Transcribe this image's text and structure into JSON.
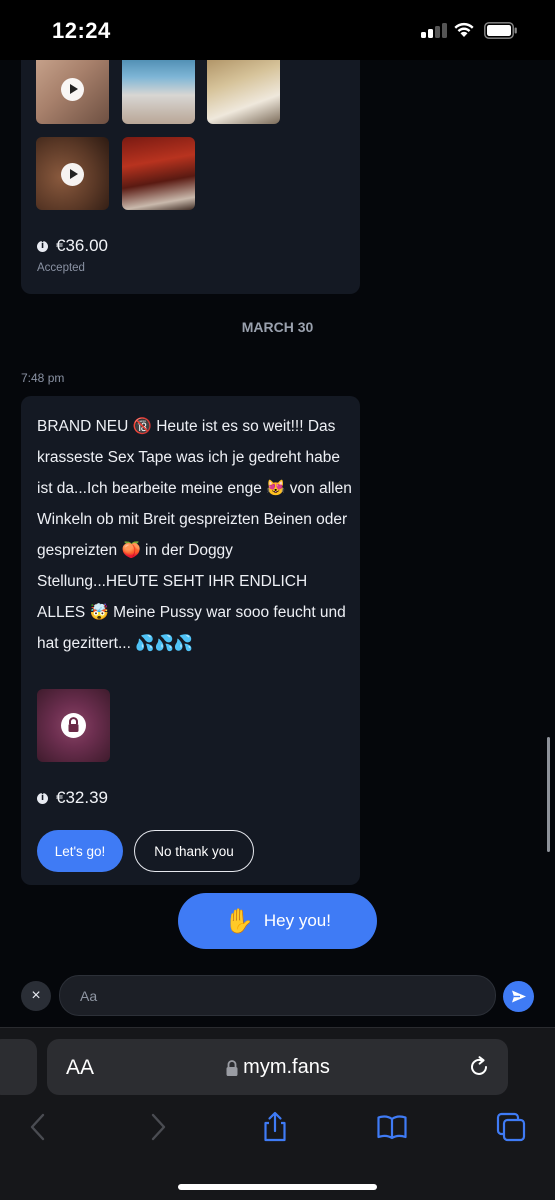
{
  "status_bar": {
    "time": "12:24"
  },
  "previous_card": {
    "price": "€36.00",
    "status": "Accepted"
  },
  "date_separator": "MARCH 30",
  "message": {
    "time": "7:48 pm",
    "text": "BRAND NEU 🔞 Heute ist es so weit!!! Das krasseste Sex Tape was ich je gedreht habe ist da...Ich bearbeite meine enge 😻 von allen Winkeln ob mit Breit gespreizten Beinen oder gespreizten 🍑 in der Doggy Stellung...HEUTE SEHT IHR ENDLICH ALLES 🤯 Meine Pussy war sooo feucht und hat gezittert... 💦💦💦",
    "price": "€32.39",
    "accept_label": "Let's go!",
    "decline_label": "No thank you"
  },
  "hey_button": {
    "emoji": "✋",
    "label": "Hey you!"
  },
  "composer": {
    "placeholder": "Aa",
    "close_icon": "×"
  },
  "browser": {
    "text_size_label": "AA",
    "url": "mym.fans"
  },
  "colors": {
    "accent": "#3f7bf5",
    "card_bg": "#141923",
    "page_bg": "#05070b"
  }
}
